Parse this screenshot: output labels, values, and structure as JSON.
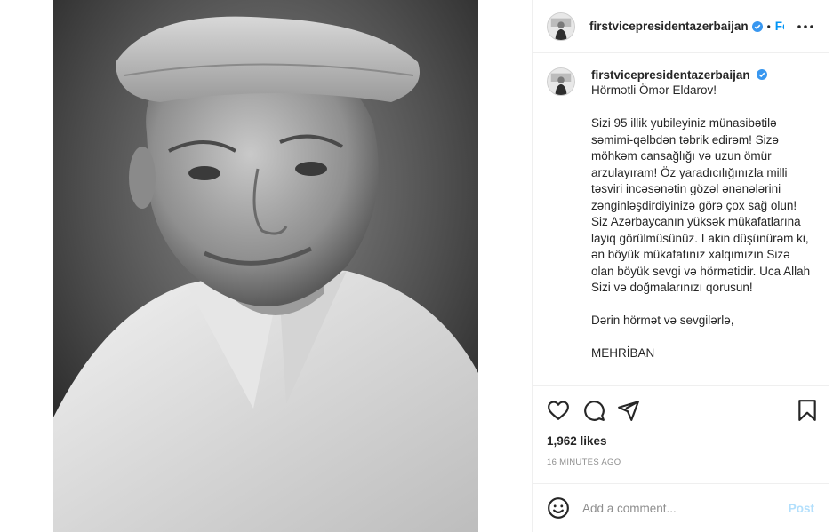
{
  "post": {
    "username": "firstvicepresidentazerbaijan",
    "separator": "•",
    "follow_label": "Follow",
    "caption": {
      "username": "firstvicepresidentazerbaijan",
      "text": "Hörmətli Ömər Eldarov!\n\nSizi 95 illik yubileyiniz münasibətilə səmimi-qəlbdən təbrik edirəm! Sizə möhkəm cansağlığı və uzun ömür arzulayıram! Öz yaradıcılığınızla milli təsviri incəsənətin gözəl ənənələrini zənginləşdirdiyinizə görə çox sağ olun! Siz Azərbaycanın yüksək mükafatlarına layiq görülmüsünüz. Lakin düşünürəm ki, ən böyük mükafatınız xalqımızın Sizə olan böyük sevgi və hörmətidir. Uca Allah Sizi və doğmalarınızı qorusun!\n\nDərin hörmət və sevgilərlə,\n\nMEHRİBAN"
    },
    "likes": "1,962 likes",
    "timestamp": "16 MINUTES AGO"
  },
  "comment": {
    "placeholder": "Add a comment...",
    "post_label": "Post"
  },
  "colors": {
    "accent": "#0095f6",
    "verified": "#3897f0",
    "post_disabled": "#b2dffc",
    "border": "#efefef",
    "muted": "#8e8e8e"
  },
  "icons": {
    "verified": "verified-badge-icon",
    "more": "more-options-icon",
    "like": "heart-icon",
    "comment": "comment-icon",
    "share": "share-icon",
    "save": "bookmark-icon",
    "emoji": "emoji-icon"
  }
}
